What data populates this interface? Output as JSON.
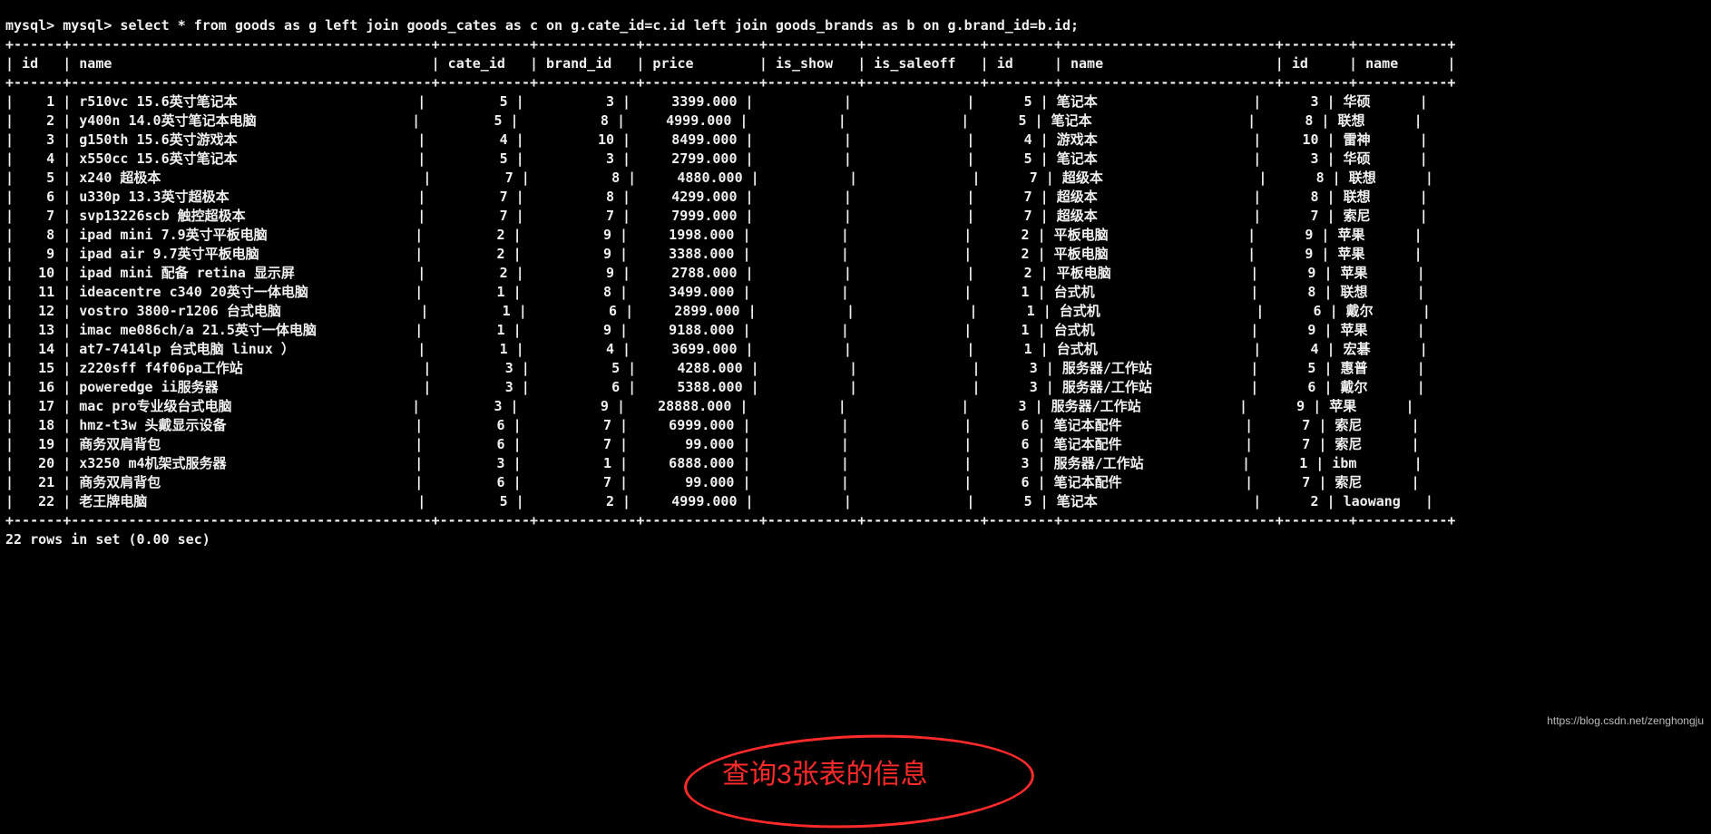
{
  "prompt": "mysql> mysql> select * from goods as g left join goods_cates as c on g.cate_id=c.id left join goods_brands as b on g.brand_id=b.id;",
  "columns": [
    "id",
    "name",
    "cate_id",
    "brand_id",
    "price",
    "is_show",
    "is_saleoff",
    "id",
    "name",
    "id",
    "name"
  ],
  "rows": [
    {
      "id": "1",
      "name": "r510vc 15.6英寸笔记本",
      "cate_id": "5",
      "brand_id": "3",
      "price": "3399.000",
      "is_show": "",
      "is_saleoff": "",
      "c_id": "5",
      "c_name": "笔记本",
      "b_id": "3",
      "b_name": "华硕"
    },
    {
      "id": "2",
      "name": "y400n 14.0英寸笔记本电脑",
      "cate_id": "5",
      "brand_id": "8",
      "price": "4999.000",
      "is_show": "",
      "is_saleoff": "",
      "c_id": "5",
      "c_name": "笔记本",
      "b_id": "8",
      "b_name": "联想"
    },
    {
      "id": "3",
      "name": "g150th 15.6英寸游戏本",
      "cate_id": "4",
      "brand_id": "10",
      "price": "8499.000",
      "is_show": "",
      "is_saleoff": "",
      "c_id": "4",
      "c_name": "游戏本",
      "b_id": "10",
      "b_name": "雷神"
    },
    {
      "id": "4",
      "name": "x550cc 15.6英寸笔记本",
      "cate_id": "5",
      "brand_id": "3",
      "price": "2799.000",
      "is_show": "",
      "is_saleoff": "",
      "c_id": "5",
      "c_name": "笔记本",
      "b_id": "3",
      "b_name": "华硕"
    },
    {
      "id": "5",
      "name": "x240 超极本",
      "cate_id": "7",
      "brand_id": "8",
      "price": "4880.000",
      "is_show": "",
      "is_saleoff": "",
      "c_id": "7",
      "c_name": "超级本",
      "b_id": "8",
      "b_name": "联想"
    },
    {
      "id": "6",
      "name": "u330p 13.3英寸超极本",
      "cate_id": "7",
      "brand_id": "8",
      "price": "4299.000",
      "is_show": "",
      "is_saleoff": "",
      "c_id": "7",
      "c_name": "超级本",
      "b_id": "8",
      "b_name": "联想"
    },
    {
      "id": "7",
      "name": "svp13226scb 触控超极本",
      "cate_id": "7",
      "brand_id": "7",
      "price": "7999.000",
      "is_show": "",
      "is_saleoff": "",
      "c_id": "7",
      "c_name": "超级本",
      "b_id": "7",
      "b_name": "索尼"
    },
    {
      "id": "8",
      "name": "ipad mini 7.9英寸平板电脑",
      "cate_id": "2",
      "brand_id": "9",
      "price": "1998.000",
      "is_show": "",
      "is_saleoff": "",
      "c_id": "2",
      "c_name": "平板电脑",
      "b_id": "9",
      "b_name": "苹果"
    },
    {
      "id": "9",
      "name": "ipad air 9.7英寸平板电脑",
      "cate_id": "2",
      "brand_id": "9",
      "price": "3388.000",
      "is_show": "",
      "is_saleoff": "",
      "c_id": "2",
      "c_name": "平板电脑",
      "b_id": "9",
      "b_name": "苹果"
    },
    {
      "id": "10",
      "name": "ipad mini 配备 retina 显示屏",
      "cate_id": "2",
      "brand_id": "9",
      "price": "2788.000",
      "is_show": "",
      "is_saleoff": "",
      "c_id": "2",
      "c_name": "平板电脑",
      "b_id": "9",
      "b_name": "苹果"
    },
    {
      "id": "11",
      "name": "ideacentre c340 20英寸一体电脑",
      "cate_id": "1",
      "brand_id": "8",
      "price": "3499.000",
      "is_show": "",
      "is_saleoff": "",
      "c_id": "1",
      "c_name": "台式机",
      "b_id": "8",
      "b_name": "联想"
    },
    {
      "id": "12",
      "name": "vostro 3800-r1206 台式电脑",
      "cate_id": "1",
      "brand_id": "6",
      "price": "2899.000",
      "is_show": "",
      "is_saleoff": "",
      "c_id": "1",
      "c_name": "台式机",
      "b_id": "6",
      "b_name": "戴尔"
    },
    {
      "id": "13",
      "name": "imac me086ch/a 21.5英寸一体电脑",
      "cate_id": "1",
      "brand_id": "9",
      "price": "9188.000",
      "is_show": "",
      "is_saleoff": "",
      "c_id": "1",
      "c_name": "台式机",
      "b_id": "9",
      "b_name": "苹果"
    },
    {
      "id": "14",
      "name": "at7-7414lp 台式电脑 linux ）",
      "cate_id": "1",
      "brand_id": "4",
      "price": "3699.000",
      "is_show": "",
      "is_saleoff": "",
      "c_id": "1",
      "c_name": "台式机",
      "b_id": "4",
      "b_name": "宏碁"
    },
    {
      "id": "15",
      "name": "z220sff f4f06pa工作站",
      "cate_id": "3",
      "brand_id": "5",
      "price": "4288.000",
      "is_show": "",
      "is_saleoff": "",
      "c_id": "3",
      "c_name": "服务器/工作站",
      "b_id": "5",
      "b_name": "惠普"
    },
    {
      "id": "16",
      "name": "poweredge ii服务器",
      "cate_id": "3",
      "brand_id": "6",
      "price": "5388.000",
      "is_show": "",
      "is_saleoff": "",
      "c_id": "3",
      "c_name": "服务器/工作站",
      "b_id": "6",
      "b_name": "戴尔"
    },
    {
      "id": "17",
      "name": "mac pro专业级台式电脑",
      "cate_id": "3",
      "brand_id": "9",
      "price": "28888.000",
      "is_show": "",
      "is_saleoff": "",
      "c_id": "3",
      "c_name": "服务器/工作站",
      "b_id": "9",
      "b_name": "苹果"
    },
    {
      "id": "18",
      "name": "hmz-t3w 头戴显示设备",
      "cate_id": "6",
      "brand_id": "7",
      "price": "6999.000",
      "is_show": "",
      "is_saleoff": "",
      "c_id": "6",
      "c_name": "笔记本配件",
      "b_id": "7",
      "b_name": "索尼"
    },
    {
      "id": "19",
      "name": "商务双肩背包",
      "cate_id": "6",
      "brand_id": "7",
      "price": "99.000",
      "is_show": "",
      "is_saleoff": "",
      "c_id": "6",
      "c_name": "笔记本配件",
      "b_id": "7",
      "b_name": "索尼"
    },
    {
      "id": "20",
      "name": "x3250 m4机架式服务器",
      "cate_id": "3",
      "brand_id": "1",
      "price": "6888.000",
      "is_show": "",
      "is_saleoff": "",
      "c_id": "3",
      "c_name": "服务器/工作站",
      "b_id": "1",
      "b_name": "ibm"
    },
    {
      "id": "21",
      "name": "商务双肩背包",
      "cate_id": "6",
      "brand_id": "7",
      "price": "99.000",
      "is_show": "",
      "is_saleoff": "",
      "c_id": "6",
      "c_name": "笔记本配件",
      "b_id": "7",
      "b_name": "索尼"
    },
    {
      "id": "22",
      "name": "老王牌电脑",
      "cate_id": "5",
      "brand_id": "2",
      "price": "4999.000",
      "is_show": "",
      "is_saleoff": "",
      "c_id": "5",
      "c_name": "笔记本",
      "b_id": "2",
      "b_name": "laowang"
    }
  ],
  "footer": "22 rows in set (0.00 sec)",
  "annotation": "查询3张表的信息",
  "watermark": "https://blog.csdn.net/zenghongju"
}
